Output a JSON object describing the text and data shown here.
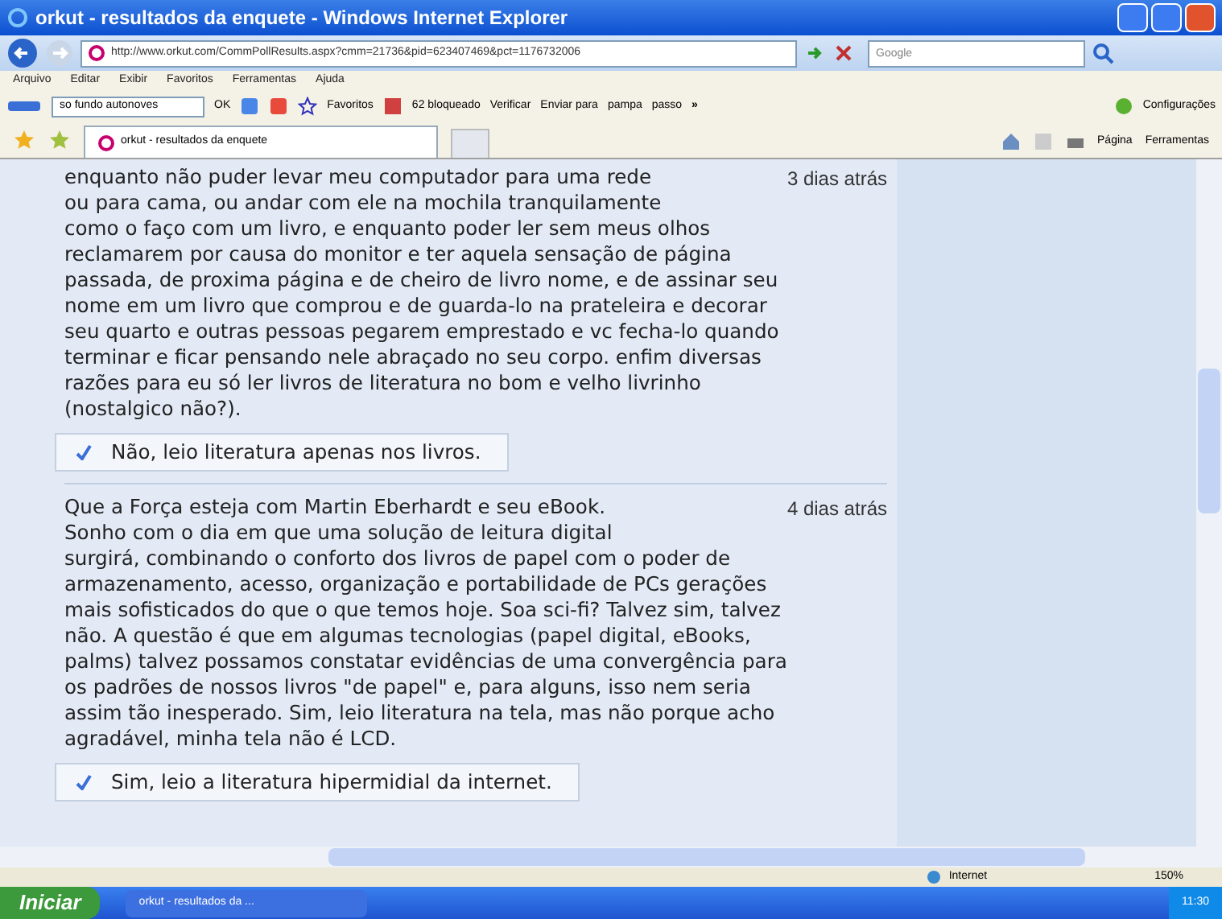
{
  "window": {
    "title": "orkut - resultados da enquete - Windows Internet Explorer"
  },
  "address_bar": {
    "url": "http://www.orkut.com/CommPollResults.aspx?cmm=21736&pid=623407469&pct=1176732006",
    "search_placeholder": "Google"
  },
  "menu": [
    "Arquivo",
    "Editar",
    "Exibir",
    "Favoritos",
    "Ferramentas",
    "Ajuda"
  ],
  "google_toolbar": {
    "search_value": "so fundo autonoves",
    "ok": "OK",
    "favorites": "Favoritos",
    "blocked": "62 bloqueado",
    "check": "Verificar",
    "send": "Enviar para",
    "bookmarks": [
      "pampa",
      "passo"
    ],
    "more": "»",
    "settings": "Configurações"
  },
  "tab": {
    "title": "orkut - resultados da enquete"
  },
  "command_bar": {
    "page": "Página",
    "tools": "Ferramentas"
  },
  "posts": [
    {
      "text": "enquanto não puder levar meu computador para uma rede\nou para cama, ou andar com ele na mochila tranquilamente\ncomo o faço com um livro, e enquanto poder ler sem meus olhos\nreclamarem por causa do monitor e ter aquela sensação de página\npassada, de proxima página e de cheiro de livro nome, e de assinar seu\nnome em um livro que comprou e de guarda-lo na prateleira e decorar\nseu quarto e outras pessoas pegarem emprestado e vc fecha-lo quando\nterminar e ficar pensando nele abraçado no seu corpo. enfim diversas\nrazões para eu só ler livros de literatura no bom e velho livrinho\n(nostalgico não?).",
      "time": "3 dias atrás",
      "answer": "Não, leio literatura apenas nos livros."
    },
    {
      "text": "Que a Força esteja com Martin Eberhardt e seu eBook.\nSonho com o dia em que uma solução de leitura digital\nsurgirá, combinando o conforto dos livros de papel com o poder de\narmazenamento, acesso, organização e portabilidade de PCs gerações\nmais sofisticados do que o que temos hoje. Soa sci-fi? Talvez sim, talvez\nnão. A questão é que em algumas tecnologias (papel digital, eBooks,\npalms) talvez possamos constatar evidências de uma convergência para\nos padrões de nossos livros \"de papel\" e, para alguns, isso nem seria\nassim tão inesperado. Sim, leio literatura na tela, mas não porque acho\nagradável, minha tela não é LCD.",
      "time": "4 dias atrás",
      "answer": "Sim, leio a literatura hipermidial da internet."
    }
  ],
  "status_bar": {
    "zone": "Internet",
    "zoom": "150%"
  },
  "taskbar": {
    "start": "Iniciar",
    "task": "orkut - resultados da ...",
    "clock": "11:30"
  }
}
